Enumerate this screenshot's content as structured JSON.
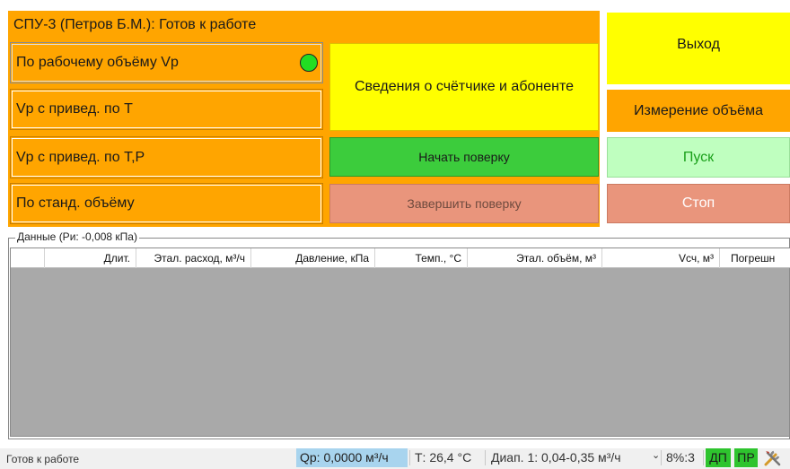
{
  "header": {
    "title": "СПУ-3 (Петров Б.М.): Готов к работе"
  },
  "modes": [
    {
      "label": "По рабочему объёму Vр"
    },
    {
      "label": "Vр с привед. по Т"
    },
    {
      "label": "Vр с привед. по Т,Р"
    },
    {
      "label": "По станд. объёму"
    }
  ],
  "info_button": {
    "label": "Сведения о счётчике и абоненте"
  },
  "start_verification": {
    "label": "Начать поверку"
  },
  "finish_verification": {
    "label": "Завершить поверку"
  },
  "exit_button": {
    "label": "Выход"
  },
  "measure_label": "Измерение объёма",
  "start_button": {
    "label": "Пуск"
  },
  "stop_button": {
    "label": "Стоп"
  },
  "data_group": {
    "label": "Данные (Ри: -0,008 кПа)",
    "columns": [
      "Длит.",
      "Этал. расход, м³/ч",
      "Давление, кПа",
      "Темп., °С",
      "Этал. объём, м³",
      "Vсч, м³",
      "Погрешн"
    ]
  },
  "status_bar": {
    "status": "Готов к работе",
    "qp": "Qр: 0,0000 м³/ч",
    "temp": "Т: 26,4 °С",
    "range": "Диап. 1: 0,04-0,35 м³/ч",
    "range_arrow": "⌄",
    "percent": "8%:3",
    "dp": "ДП",
    "pr": "ПР"
  },
  "colors": {
    "orange": "#ffa500",
    "yellow": "#ffff00",
    "green": "#3ccc3c",
    "pale_green": "#bfffbf",
    "salmon": "#e9957c",
    "grid_gray": "#a9a9a9",
    "indicator": "#22dd22"
  },
  "icons": {
    "tools": "tools-icon",
    "indicator": "status-indicator"
  }
}
